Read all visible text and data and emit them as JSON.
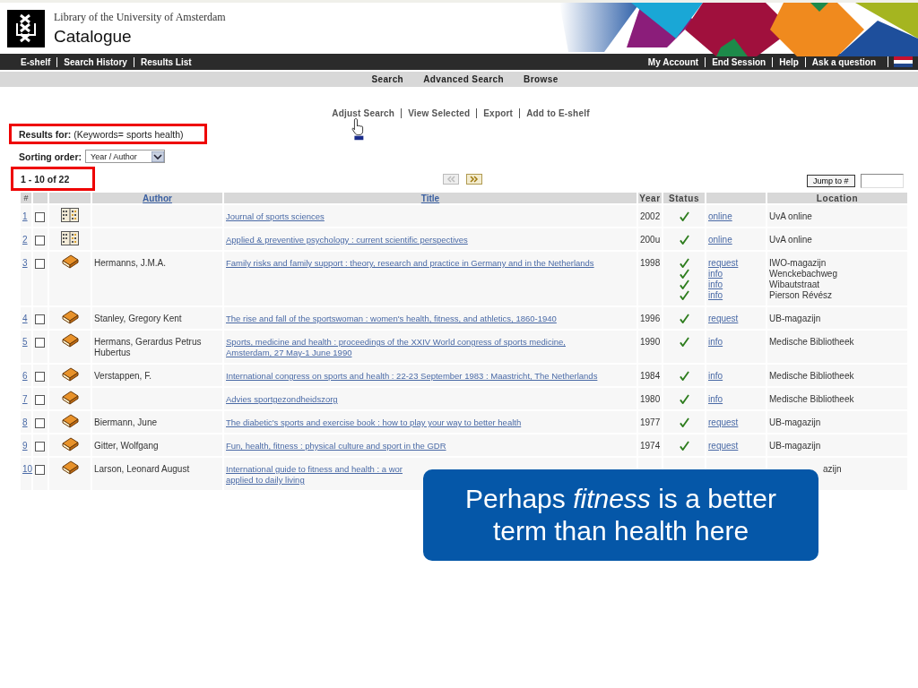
{
  "header": {
    "library": "Library of the University of Amsterdam",
    "title": "Catalogue"
  },
  "top_bar": {
    "left": [
      "E-shelf",
      "Search History",
      "Results List"
    ],
    "right": [
      "My Account",
      "End Session",
      "Help",
      "Ask a question"
    ]
  },
  "nav": [
    "Search",
    "Advanced Search",
    "Browse"
  ],
  "actions": [
    "Adjust Search",
    "View Selected",
    "Export",
    "Add to E-shelf"
  ],
  "results_for": {
    "label": "Results for:",
    "query": "(Keywords= sports health)"
  },
  "sorting": {
    "label": "Sorting order:",
    "value": "Year / Author"
  },
  "count": "1 - 10 of 22",
  "jump_button": "Jump to #",
  "table": {
    "columns": [
      {
        "label": "#",
        "link": false
      },
      {
        "label": "Author",
        "link": true
      },
      {
        "label": "Title",
        "link": true
      },
      {
        "label": "Year",
        "link": false
      },
      {
        "label": "Status",
        "link": false
      },
      {
        "label": "Location",
        "link": false
      }
    ],
    "rows": [
      {
        "number": "1",
        "checked": false,
        "kind": "journal",
        "author": "",
        "title": [
          "Journal of sports sciences"
        ],
        "year": "2002",
        "holdings": [
          {
            "available": true,
            "link": "online",
            "location": "UvA online"
          }
        ]
      },
      {
        "number": "2",
        "checked": false,
        "kind": "journal",
        "author": "",
        "title": [
          "Applied & preventive psychology : current scientific perspectives"
        ],
        "year": "200u",
        "holdings": [
          {
            "available": true,
            "link": "online",
            "location": "UvA online"
          }
        ]
      },
      {
        "number": "3",
        "checked": false,
        "kind": "book",
        "author": "Hermanns, J.M.A.",
        "title": [
          "Family risks and family support : theory, research and practice in Germany and in the Netherlands"
        ],
        "year": "1998",
        "holdings": [
          {
            "available": true,
            "link": "request",
            "location": "IWO-magazijn"
          },
          {
            "available": true,
            "link": "info",
            "location": "Wenckebachweg"
          },
          {
            "available": true,
            "link": "info",
            "location": "Wibautstraat"
          },
          {
            "available": true,
            "link": "info",
            "location": "Pierson Révész"
          }
        ]
      },
      {
        "number": "4",
        "checked": false,
        "kind": "book",
        "author": "Stanley, Gregory Kent",
        "title": [
          "The rise and fall of the sportswoman : women's health, fitness, and athletics, 1860-1940"
        ],
        "year": "1996",
        "holdings": [
          {
            "available": true,
            "link": "request",
            "location": "UB-magazijn"
          }
        ]
      },
      {
        "number": "5",
        "checked": false,
        "kind": "book",
        "author": "Hermans, Gerardus Petrus Hubertus",
        "title": [
          "Sports, medicine and health : proceedings of the XXIV World congress of sports medicine,",
          "Amsterdam, 27 May-1 June 1990"
        ],
        "year": "1990",
        "holdings": [
          {
            "available": true,
            "link": "info",
            "location": "Medische Bibliotheek"
          }
        ]
      },
      {
        "number": "6",
        "checked": false,
        "kind": "book",
        "author": "Verstappen, F.",
        "title": [
          "International congress on sports and health : 22-23 September 1983 : Maastricht, The Netherlands"
        ],
        "year": "1984",
        "holdings": [
          {
            "available": true,
            "link": "info",
            "location": "Medische Bibliotheek"
          }
        ]
      },
      {
        "number": "7",
        "checked": false,
        "kind": "book",
        "author": "",
        "title": [
          "Advies sportgezondheidszorg"
        ],
        "year": "1980",
        "holdings": [
          {
            "available": true,
            "link": "info",
            "location": "Medische Bibliotheek"
          }
        ]
      },
      {
        "number": "8",
        "checked": false,
        "kind": "book",
        "author": "Biermann, June",
        "title": [
          "The diabetic's sports and exercise book : how to play your way to better health"
        ],
        "year": "1977",
        "holdings": [
          {
            "available": true,
            "link": "request",
            "location": "UB-magazijn"
          }
        ]
      },
      {
        "number": "9",
        "checked": false,
        "kind": "book",
        "author": "Gitter, Wolfgang",
        "title": [
          "Fun, health, fitness : physical culture and sport in the GDR"
        ],
        "year": "1974",
        "holdings": [
          {
            "available": true,
            "link": "request",
            "location": "UB-magazijn"
          }
        ]
      },
      {
        "number": "10",
        "checked": false,
        "kind": "book",
        "author": "Larson, Leonard August",
        "title": [
          "International guide to fitness and health : a wor",
          "applied to daily living"
        ],
        "covered": true,
        "holdings": [
          {
            "location": "azijn"
          }
        ]
      }
    ]
  },
  "callout": "Perhaps *fitness* is a better term than health here"
}
